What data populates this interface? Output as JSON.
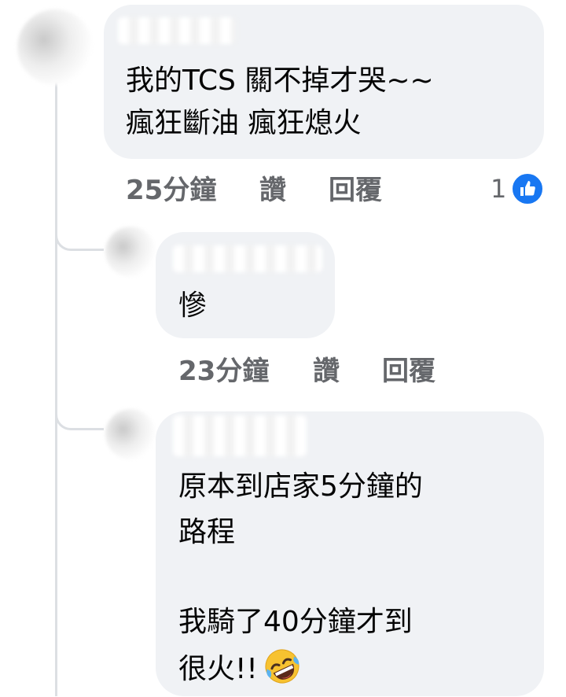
{
  "main_comment": {
    "text_line1": "我的TCS 關不掉才哭~~",
    "text_line2": "瘋狂斷油 瘋狂熄火",
    "time": "25分鐘",
    "like_label": "讚",
    "reply_label": "回覆",
    "reaction_count": "1",
    "reaction_icon": "like-thumb-icon"
  },
  "reply_1": {
    "text": "慘",
    "time": "23分鐘",
    "like_label": "讚",
    "reply_label": "回覆"
  },
  "reply_2": {
    "text_line1": "原本到店家5分鐘的",
    "text_line2": "路程",
    "text_line3": "我騎了40分鐘才到",
    "text_line4": "很火!!",
    "emoji": "rolling-on-floor-laughing-emoji"
  },
  "colors": {
    "bubble": "#f0f2f5",
    "meta_text": "#65676b",
    "like_blue": "#1877f2"
  }
}
